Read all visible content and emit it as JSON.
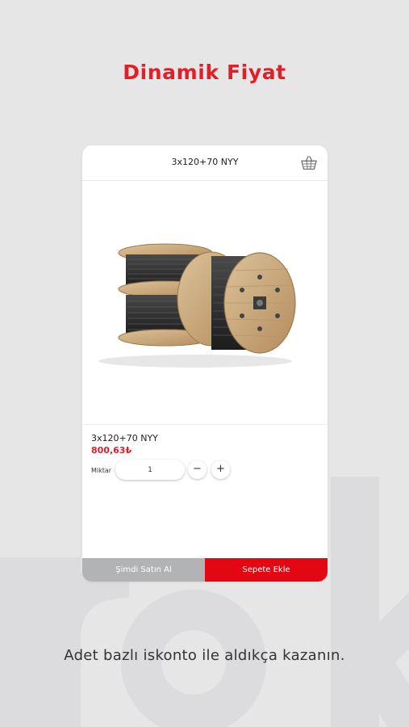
{
  "headline": "Dinamik Fiyat",
  "header": {
    "title": "3x120+70 NYY",
    "basket_icon": "basket-icon"
  },
  "product": {
    "image_alt": "cable-reels-image",
    "name": "3x120+70 NYY",
    "price": "800,63₺"
  },
  "quantity": {
    "label": "Miktar",
    "value": "1",
    "decrement": "−",
    "increment": "+"
  },
  "actions": {
    "buy_now": "Şimdi Satın Al",
    "add_to_cart": "Sepete Ekle"
  },
  "tagline": "Adet bazlı iskonto ile aldıkça kazanın.",
  "colors": {
    "brand": "#e41e26",
    "secondary_button": "#b2b3b5",
    "background": "#e6e6e7"
  }
}
